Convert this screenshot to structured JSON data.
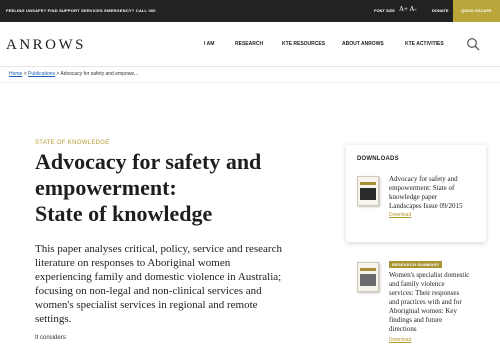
{
  "topbar": {
    "left_text": "FEELING UNSAFE? FIND SUPPORT SERVICES   EMERGENCY? CALL 000",
    "font_size_label": "FONT SIZE",
    "font_controls": "A+  A-",
    "donate": "DONATE",
    "quick_escape": "QUICK ESCAPE"
  },
  "header": {
    "logo": "ANROWS",
    "nav": [
      "I AM",
      "RESEARCH",
      "KTE RESOURCES",
      "ABOUT ANROWS",
      "KTE ACTIVITIES"
    ],
    "search_icon": "search-icon"
  },
  "breadcrumb": {
    "home": "Home",
    "sep1": ">",
    "publications": "Publications",
    "sep2": ">",
    "current": "Advocacy for safety and empowe..."
  },
  "main": {
    "kicker": "STATE OF KNOWLEDGE",
    "title_lines": [
      "Advocacy for safety and",
      "empowerment:",
      "State of knowledge"
    ],
    "abstract_lines": [
      "This paper analyses critical, policy, service and research",
      "literature on responses to Aboriginal women",
      "experiencing family and domestic violence in Australia;",
      "focusing on non-legal and non-clinical services and",
      "women's specialist services in regional and remote",
      "settings."
    ],
    "considers": "It considers:"
  },
  "sidebar": {
    "downloads_heading": "DOWNLOADS",
    "download_doc": {
      "title_lines": [
        "Advocacy for safety and",
        "empowerment: State of",
        "knowledge paper",
        "Landscapes Issue 09/2015"
      ],
      "link": "Download"
    },
    "related": {
      "badge": "RESEARCH SUMMARY",
      "title_lines": [
        "Women's specialist domestic",
        "and family violence",
        "services: Their responses",
        "and practices with and for",
        "Aboriginal women: Key",
        "findings and future",
        "directions"
      ],
      "link": "Download"
    }
  },
  "colors": {
    "topbar_bg": "#222222",
    "accent_gold": "#b59b2e",
    "link_blue": "#1a5fb4"
  }
}
